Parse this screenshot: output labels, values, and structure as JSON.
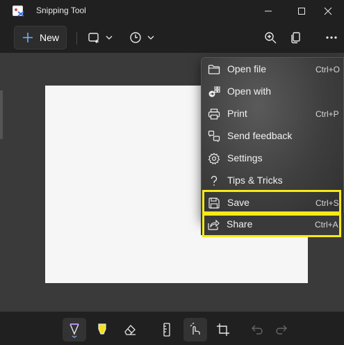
{
  "window": {
    "title": "Snipping Tool"
  },
  "toolbar": {
    "new_label": "New",
    "mode_icon": "rectangle-snip-icon",
    "delay_icon": "clock-icon"
  },
  "menu": {
    "items": [
      {
        "label": "Open file",
        "shortcut": "Ctrl+O",
        "icon": "folder-icon"
      },
      {
        "label": "Open with",
        "shortcut": "",
        "icon": "open-with-icon"
      },
      {
        "label": "Print",
        "shortcut": "Ctrl+P",
        "icon": "printer-icon"
      },
      {
        "label": "Send feedback",
        "shortcut": "",
        "icon": "feedback-icon"
      },
      {
        "label": "Settings",
        "shortcut": "",
        "icon": "gear-icon"
      },
      {
        "label": "Tips & Tricks",
        "shortcut": "",
        "icon": "question-icon"
      },
      {
        "label": "Save",
        "shortcut": "Ctrl+S",
        "icon": "save-icon",
        "highlighted": true
      },
      {
        "label": "Share",
        "shortcut": "Ctrl+A",
        "icon": "share-icon",
        "highlighted": true
      }
    ]
  },
  "colors": {
    "background": "#202020",
    "canvas": "#3a3a3a",
    "highlight": "#f5ea16",
    "pen_accent": "#b48cf2",
    "highlighter": "#f5e11a"
  }
}
